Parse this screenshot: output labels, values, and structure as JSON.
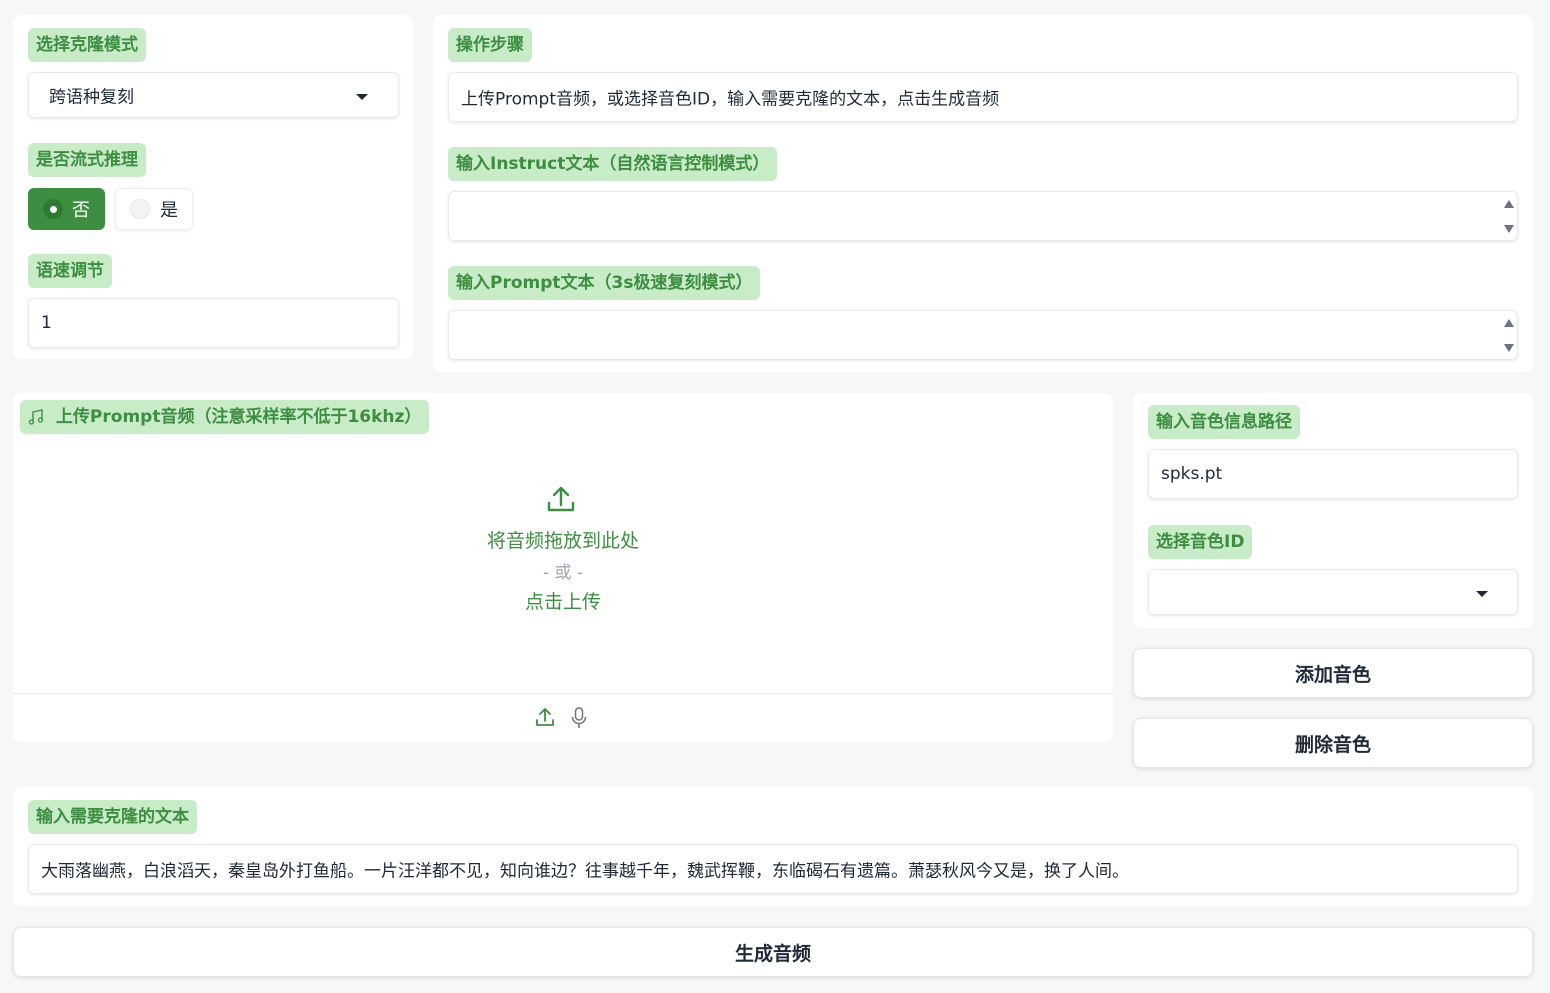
{
  "clone_mode": {
    "label": "选择克隆模式",
    "selected": "跨语种复刻"
  },
  "stream": {
    "label": "是否流式推理",
    "options": [
      {
        "label": "否",
        "selected": true
      },
      {
        "label": "是",
        "selected": false
      }
    ]
  },
  "speed": {
    "label": "语速调节",
    "value": "1"
  },
  "steps": {
    "label": "操作步骤",
    "text": "上传Prompt音频，或选择音色ID，输入需要克隆的文本，点击生成音频"
  },
  "instruct": {
    "label": "输入Instruct文本（自然语言控制模式）",
    "value": ""
  },
  "prompt_text": {
    "label": "输入Prompt文本（3s极速复刻模式）",
    "value": ""
  },
  "upload_audio": {
    "label": "上传Prompt音频（注意采样率不低于16khz）",
    "drop_text": "将音频拖放到此处",
    "or_text": "- 或 -",
    "click_text": "点击上传"
  },
  "spk_path": {
    "label": "输入音色信息路径",
    "value": "spks.pt"
  },
  "spk_id": {
    "label": "选择音色ID",
    "selected": ""
  },
  "buttons": {
    "add": "添加音色",
    "delete": "删除音色",
    "generate": "生成音频"
  },
  "tts_text": {
    "label": "输入需要克隆的文本",
    "value": "大雨落幽燕，白浪滔天，秦皇岛外打鱼船。一片汪洋都不见，知向谁边？往事越千年，魏武挥鞭，东临碣石有遗篇。萧瑟秋风今又是，换了人间。"
  },
  "colors": {
    "accent": "#3e8e41",
    "label_bg": "#c8ebc8",
    "page_bg": "#f6f7f9"
  }
}
